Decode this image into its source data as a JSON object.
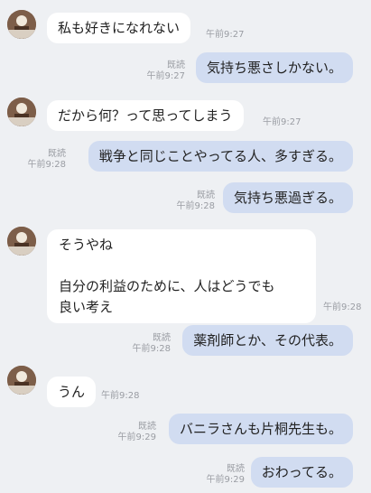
{
  "messages": [
    {
      "side": "in",
      "text": "私も好きになれない",
      "time": "午前9:27"
    },
    {
      "side": "out",
      "text": "気持ち悪さしかない。",
      "read": "既読",
      "time": "午前9:27"
    },
    {
      "side": "in",
      "text": "だから何？って思ってしまう",
      "time": "午前9:27"
    },
    {
      "side": "out",
      "text": "戦争と同じことやってる人、多すぎる。",
      "read": "既読",
      "time": "午前9:28"
    },
    {
      "side": "out",
      "text": "気持ち悪過ぎる。",
      "read": "既読",
      "time": "午前9:28"
    },
    {
      "side": "in",
      "text": "そうやね\n\n自分の利益のために、人はどうでも\n良い考え",
      "time": "午前9:28"
    },
    {
      "side": "out",
      "text": "薬剤師とか、その代表。",
      "read": "既読",
      "time": "午前9:28"
    },
    {
      "side": "in",
      "text": "うん",
      "time": "午前9:28"
    },
    {
      "side": "out",
      "text": "バニラさんも片桐先生も。",
      "read": "既読",
      "time": "午前9:29"
    },
    {
      "side": "out",
      "text": "おわってる。",
      "read": "既読",
      "time": "午前9:29"
    }
  ]
}
